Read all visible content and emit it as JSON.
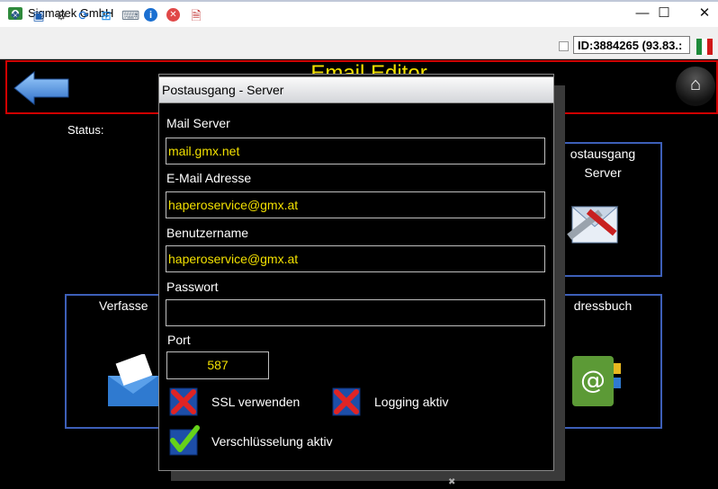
{
  "window": {
    "title": "Sigmatek GmbH",
    "minimize": "—",
    "maximize": "☐",
    "close": "✕"
  },
  "toolbar": {
    "connection_id": "ID:3884265 (93.83.:"
  },
  "hmi": {
    "title": "Email Editor",
    "status_label": "Status:",
    "tiles": {
      "outgoing": [
        "ostausgang",
        "Server"
      ],
      "compose": "Verfasse",
      "addressbook": "dressbuch"
    }
  },
  "dialog": {
    "title": "Postausgang - Server",
    "mail_server_label": "Mail Server",
    "mail_server_value": "mail.gmx.net",
    "email_label": "E-Mail Adresse",
    "email_value": "haperoservice@gmx.at",
    "username_label": "Benutzername",
    "username_value": "haperoservice@gmx.at",
    "password_label": "Passwort",
    "password_value": "",
    "port_label": "Port",
    "port_value": "587",
    "ssl_label": "SSL verwenden",
    "ssl_checked": false,
    "logging_label": "Logging aktiv",
    "logging_checked": false,
    "encryption_label": "Verschlüsselung aktiv",
    "encryption_checked": true
  },
  "colors": {
    "accent_yellow": "#f2e000",
    "header_border": "#d00000",
    "tile_border": "#3d5fb8"
  }
}
